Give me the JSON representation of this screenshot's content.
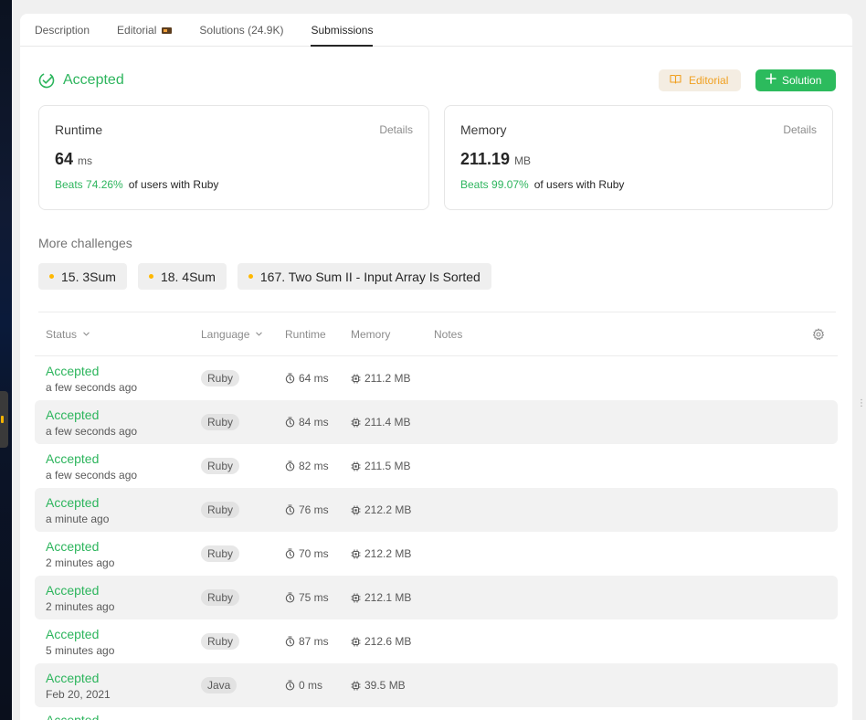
{
  "tabs": [
    {
      "label": "Description"
    },
    {
      "label": "Editorial"
    },
    {
      "label": "Solutions (24.9K)"
    },
    {
      "label": "Submissions"
    }
  ],
  "result": {
    "status": "Accepted",
    "editorial_button": "Editorial",
    "solution_button": "Solution"
  },
  "runtime": {
    "label": "Runtime",
    "details": "Details",
    "value": "64",
    "unit": "ms",
    "beats": "Beats 74.26%",
    "beats_suffix": "of users with Ruby"
  },
  "memory": {
    "label": "Memory",
    "details": "Details",
    "value": "211.19",
    "unit": "MB",
    "beats": "Beats 99.07%",
    "beats_suffix": "of users with Ruby"
  },
  "more_challenges": {
    "title": "More challenges",
    "items": [
      "15. 3Sum",
      "18. 4Sum",
      "167. Two Sum II - Input Array Is Sorted"
    ]
  },
  "table": {
    "headers": {
      "status": "Status",
      "language": "Language",
      "runtime": "Runtime",
      "memory": "Memory",
      "notes": "Notes"
    },
    "rows": [
      {
        "status": "Accepted",
        "time": "a few seconds ago",
        "language": "Ruby",
        "runtime": "64 ms",
        "memory": "211.2 MB"
      },
      {
        "status": "Accepted",
        "time": "a few seconds ago",
        "language": "Ruby",
        "runtime": "84 ms",
        "memory": "211.4 MB"
      },
      {
        "status": "Accepted",
        "time": "a few seconds ago",
        "language": "Ruby",
        "runtime": "82 ms",
        "memory": "211.5 MB"
      },
      {
        "status": "Accepted",
        "time": "a minute ago",
        "language": "Ruby",
        "runtime": "76 ms",
        "memory": "212.2 MB"
      },
      {
        "status": "Accepted",
        "time": "2 minutes ago",
        "language": "Ruby",
        "runtime": "70 ms",
        "memory": "212.2 MB"
      },
      {
        "status": "Accepted",
        "time": "2 minutes ago",
        "language": "Ruby",
        "runtime": "75 ms",
        "memory": "212.1 MB"
      },
      {
        "status": "Accepted",
        "time": "5 minutes ago",
        "language": "Ruby",
        "runtime": "87 ms",
        "memory": "212.6 MB"
      },
      {
        "status": "Accepted",
        "time": "Feb 20, 2021",
        "language": "Java",
        "runtime": "0 ms",
        "memory": "39.5 MB"
      }
    ],
    "partial_row_status": "Accepted"
  },
  "colors": {
    "accent_green": "#2db55d",
    "editorial_orange": "#f0a020",
    "challenge_dot": "#ffb800"
  }
}
